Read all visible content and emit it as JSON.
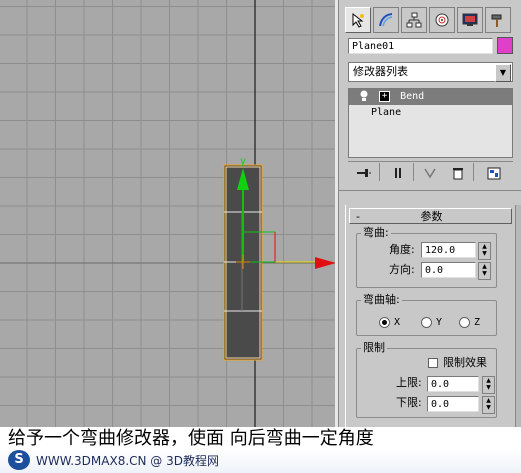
{
  "viewport": {
    "axis_label_y": "y"
  },
  "panel": {
    "tabs": [
      {
        "name": "create-tab",
        "icon": "cursor-icon"
      },
      {
        "name": "modify-tab",
        "icon": "bend-curve-icon"
      },
      {
        "name": "hierarchy-tab",
        "icon": "hierarchy-icon"
      },
      {
        "name": "motion-tab",
        "icon": "motion-icon"
      },
      {
        "name": "display-tab",
        "icon": "display-icon"
      },
      {
        "name": "utilities-tab",
        "icon": "hammer-icon"
      }
    ],
    "object_name": "Plane01",
    "object_color": "#e040c8",
    "modifier_list": "修改器列表",
    "stack": {
      "items": [
        {
          "label": "Bend",
          "selected": true
        },
        {
          "label": "Plane",
          "selected": false
        }
      ]
    }
  },
  "params": {
    "rollout_toggle": "-",
    "rollout_title": "参数",
    "bend_group": "弯曲:",
    "angle_label": "角度:",
    "angle_value": "120.0",
    "direction_label": "方向:",
    "direction_value": "0.0",
    "axis_group": "弯曲轴:",
    "axis_options": [
      "X",
      "Y",
      "Z"
    ],
    "axis_selected": "X",
    "limit_group": "限制",
    "limit_effect_label": "限制效果",
    "upper_label": "上限:",
    "upper_value": "0.0",
    "lower_label": "下限:",
    "lower_value": "0.0"
  },
  "caption": {
    "text": "给予一个弯曲修改器，使面 向后弯曲一定角度"
  },
  "watermark": {
    "logo": "S",
    "text": "WWW.3DMAX8.CN @ 3D教程网"
  }
}
